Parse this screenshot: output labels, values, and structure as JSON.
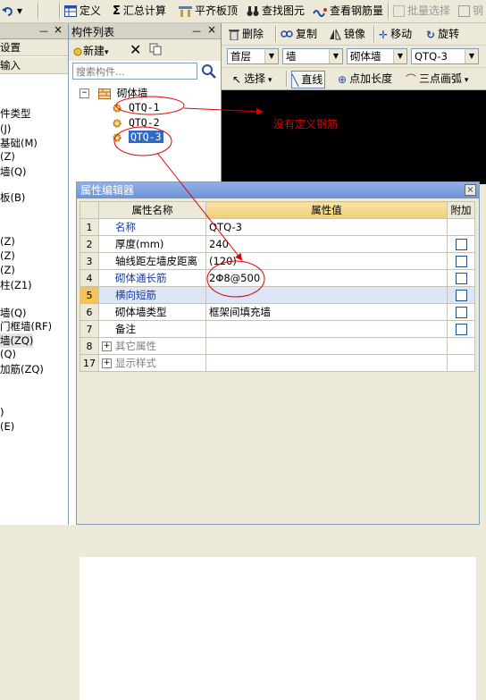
{
  "toolbar": {
    "undo_label": "",
    "items": [
      {
        "label": "定义",
        "icon": "table-icon"
      },
      {
        "label": "汇总计算",
        "icon": "sum-icon"
      },
      {
        "label": "平齐板顶",
        "icon": "align-slab-icon"
      },
      {
        "label": "查找图元",
        "icon": "find-binoculars-icon"
      },
      {
        "label": "查看钢筋量",
        "icon": "rebar-quantity-icon"
      },
      {
        "label": "批量选择",
        "icon": "batch-select-icon",
        "disabled": true
      },
      {
        "label": "钢",
        "icon": "rebar-icon",
        "disabled": true
      }
    ]
  },
  "left_panel": {
    "pin": "ᅳ",
    "close": "×",
    "buttons": [
      "设置",
      "输入"
    ],
    "items": [
      "件类型",
      "(J)",
      "基础(M)",
      "(Z)",
      "墙(Q)",
      "板(B)",
      "(Z)",
      "(Z)",
      "(Z)",
      "柱(Z1)",
      "墙(Q)",
      "门框墙(RF)",
      "墙(ZQ)",
      "(Q)",
      "加筋(ZQ)",
      ")",
      "(E)"
    ]
  },
  "component_list": {
    "title": "构件列表",
    "pin": "ᅳ",
    "close": "×",
    "new_label": "新建",
    "search_placeholder": "搜索构件...",
    "tree": {
      "root": "砌体墙",
      "children": [
        "QTQ-1",
        "QTQ-2",
        "QTQ-3"
      ],
      "selected": "QTQ-3"
    }
  },
  "right_toolbar": {
    "row1": [
      {
        "label": "删除",
        "icon": "delete-icon"
      },
      {
        "label": "复制",
        "icon": "copy-icon"
      },
      {
        "label": "镜像",
        "icon": "mirror-icon"
      },
      {
        "label": "移动",
        "icon": "move-icon"
      },
      {
        "label": "旋转",
        "icon": "rotate-icon"
      }
    ],
    "floor_combo": "首层",
    "type_combo": "墙",
    "subtype_combo": "砌体墙",
    "component_combo": "QTQ-3",
    "row3": [
      {
        "label": "选择",
        "icon": "cursor-icon"
      },
      {
        "label": "直线",
        "icon": "line-icon"
      },
      {
        "label": "点加长度",
        "icon": "point-length-icon"
      },
      {
        "label": "三点画弧",
        "icon": "arc-icon"
      }
    ]
  },
  "property_editor": {
    "title": "属性编辑器",
    "close": "×",
    "headers": {
      "num": "",
      "name": "属性名称",
      "value": "属性值",
      "extra": "附加"
    },
    "rows": [
      {
        "num": "1",
        "name": "名称",
        "value": "QTQ-3",
        "blue": true,
        "checkbox": false
      },
      {
        "num": "2",
        "name": "厚度(mm)",
        "value": "240",
        "blue": false,
        "checkbox": true
      },
      {
        "num": "3",
        "name": "轴线距左墙皮距离",
        "value": "(120)",
        "blue": false,
        "checkbox": true
      },
      {
        "num": "4",
        "name": "砌体通长筋",
        "value": "2Φ8@500",
        "blue": true,
        "checkbox": true
      },
      {
        "num": "5",
        "name": "横向短筋",
        "value": "",
        "blue": true,
        "checkbox": true,
        "selected": true
      },
      {
        "num": "6",
        "name": "砌体墙类型",
        "value": "框架间填充墙",
        "blue": false,
        "checkbox": true
      },
      {
        "num": "7",
        "name": "备注",
        "value": "",
        "blue": false,
        "checkbox": true
      },
      {
        "num": "8",
        "name": "其它属性",
        "value": "",
        "group": true
      },
      {
        "num": "17",
        "name": "显示样式",
        "value": "",
        "group": true
      }
    ]
  },
  "annotation": {
    "text": "没有定义钢筋",
    "color": "#e00000"
  },
  "colors": {
    "selection_blue": "#316ac5",
    "header_orange": "#f0cf74",
    "canvas_black": "#000000",
    "annotation_red": "#e00000"
  }
}
